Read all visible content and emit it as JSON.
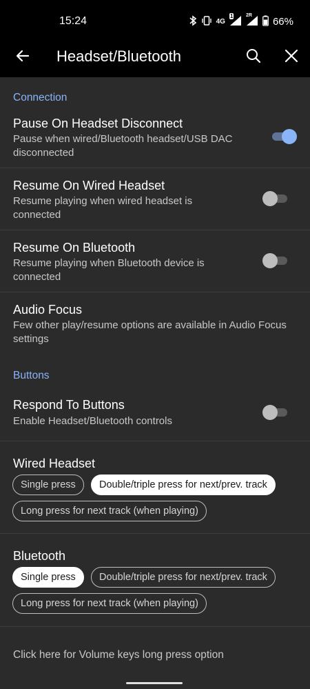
{
  "status_bar": {
    "time": "15:24",
    "network": "4G",
    "sim1": "1",
    "sim2": "2R",
    "battery": "66%"
  },
  "app_bar": {
    "title": "Headset/Bluetooth",
    "back_icon": "arrow-back-icon",
    "search_icon": "search-icon",
    "close_icon": "close-icon"
  },
  "sections": {
    "connection": "Connection",
    "buttons": "Buttons"
  },
  "prefs": {
    "pause_disconnect": {
      "title": "Pause On Headset Disconnect",
      "summary": "Pause when wired/Bluetooth headset/USB DAC disconnected",
      "enabled": true
    },
    "resume_wired": {
      "title": "Resume On Wired Headset",
      "summary": "Resume playing when wired headset is connected",
      "enabled": false
    },
    "resume_bluetooth": {
      "title": "Resume On Bluetooth",
      "summary": "Resume playing when Bluetooth device is connected",
      "enabled": false
    },
    "audio_focus": {
      "title": "Audio Focus",
      "summary": "Few other play/resume options are available in Audio Focus settings"
    },
    "respond_buttons": {
      "title": "Respond To Buttons",
      "summary": "Enable Headset/Bluetooth controls",
      "enabled": false
    }
  },
  "wired_headset": {
    "title": "Wired Headset",
    "chips": [
      "Single press",
      "Double/triple press for next/prev. track",
      "Long press for next track (when playing)"
    ],
    "selected": [
      false,
      true,
      false
    ]
  },
  "bluetooth": {
    "title": "Bluetooth",
    "chips": [
      "Single press",
      "Double/triple press for next/prev. track",
      "Long press for next track (when playing)"
    ],
    "selected": [
      true,
      false,
      false
    ]
  },
  "footer": {
    "volume_keys_link": "Click here for Volume keys long press option"
  },
  "colors": {
    "accent": "#8ab4f8",
    "background": "#2b2b2b",
    "bar": "#000000"
  }
}
